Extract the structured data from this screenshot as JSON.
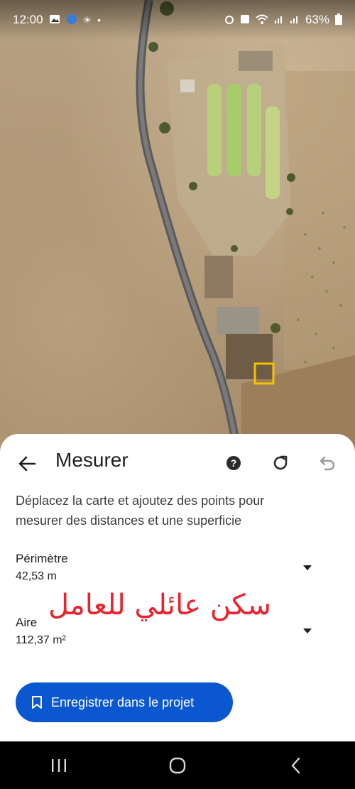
{
  "status_bar": {
    "time": "12:00",
    "battery": "63%",
    "left_icons": [
      "gallery-icon",
      "app-icon",
      "sun-icon",
      "dot-icon"
    ],
    "right_icons": [
      "alarm-icon",
      "nfc-icon",
      "wifi-icon",
      "signal-icon",
      "signal-icon",
      "battery-icon"
    ]
  },
  "sheet": {
    "title": "Mesurer",
    "instructions": "Déplacez la carte et ajoutez des points pour mesurer des distances et une superficie",
    "perimeter": {
      "label": "Périmètre",
      "value": "42,53 m"
    },
    "area": {
      "label": "Aire",
      "value": "112,37 m²"
    },
    "overlay_text": "سكن عائلي للعامل",
    "save_button_label": "Enregistrer dans le projet"
  },
  "colors": {
    "accent": "#0b57d0",
    "overlay_text": "#e8232f",
    "measure_outline": "#f5c400"
  }
}
